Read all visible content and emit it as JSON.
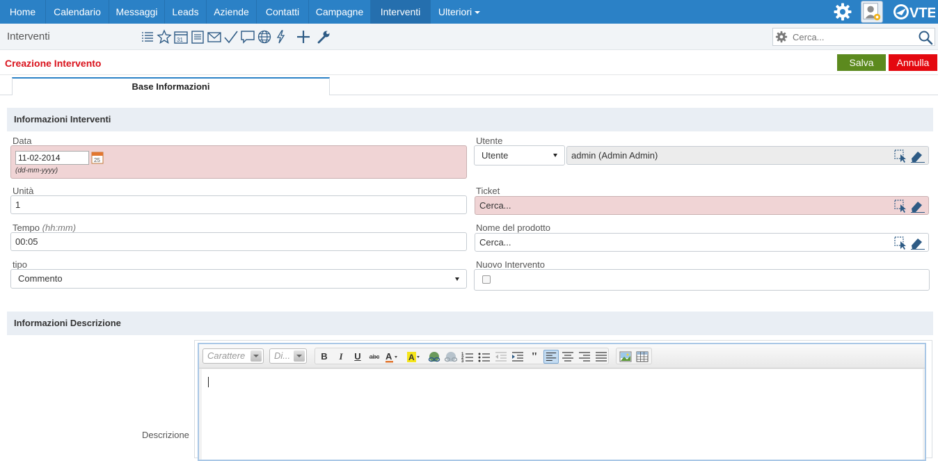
{
  "nav": {
    "items": [
      "Home",
      "Calendario",
      "Messaggi",
      "Leads",
      "Aziende",
      "Contatti",
      "Campagne",
      "Interventi"
    ],
    "more_label": "Ulteriori",
    "active": "Interventi",
    "logo_text": "VTE"
  },
  "subbar": {
    "module_title": "Interventi",
    "search_placeholder": "Cerca..."
  },
  "page": {
    "title": "Creazione Intervento",
    "save_label": "Salva",
    "cancel_label": "Annulla",
    "tab_label": "Base Informazioni"
  },
  "section1": {
    "title": "Informazioni Interventi",
    "fields": {
      "data_label": "Data",
      "data_value": "11-02-2014",
      "data_format": "(dd-mm-yyyy)",
      "utente_label": "Utente",
      "utente_type": "Utente",
      "utente_value": "admin (Admin Admin)",
      "unita_label": "Unità",
      "unita_value": "1",
      "ticket_label": "Ticket",
      "ticket_value": "Cerca...",
      "tempo_label": "Tempo",
      "tempo_hint": "(hh:mm)",
      "tempo_value": "00:05",
      "prodotto_label": "Nome del prodotto",
      "prodotto_value": "Cerca...",
      "tipo_label": "tipo",
      "tipo_value": "Commento",
      "nuovo_label": "Nuovo Intervento"
    }
  },
  "section2": {
    "title": "Informazioni Descrizione",
    "desc_label": "Descrizione",
    "font_placeholder": "Carattere",
    "size_placeholder": "Di..."
  },
  "colors": {
    "nav_bg": "#2b81c6",
    "title_red": "#d9121c",
    "save_green": "#5c8a1e",
    "cancel_red": "#e4080f",
    "required_bg": "#f0d4d5"
  }
}
